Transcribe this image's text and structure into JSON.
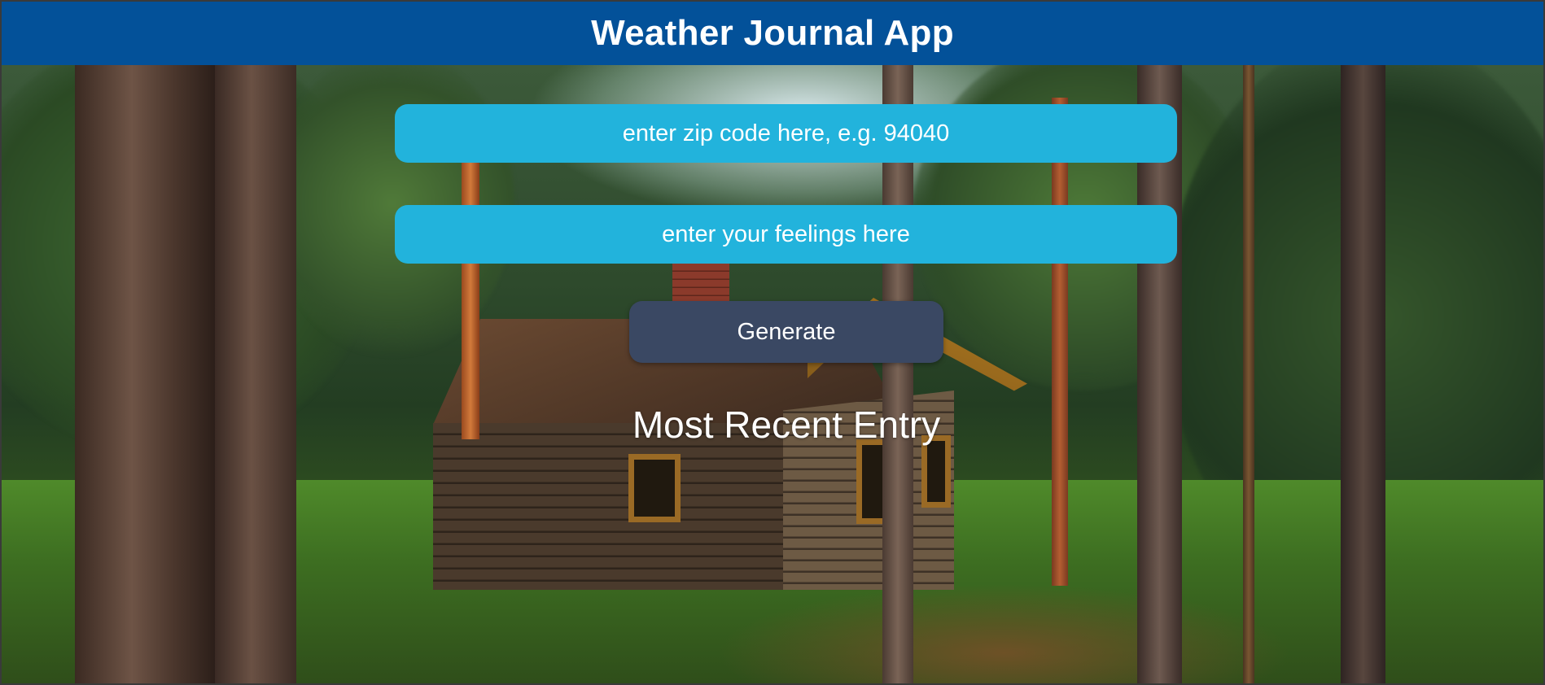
{
  "header": {
    "title": "Weather Journal App"
  },
  "form": {
    "zip_placeholder": "enter zip code here, e.g. 94040",
    "feelings_placeholder": "enter your feelings here",
    "generate_label": "Generate"
  },
  "entry": {
    "title": "Most Recent Entry"
  },
  "colors": {
    "header_bg": "#035199",
    "input_bg": "#22b3dc",
    "button_bg": "#3a4863",
    "text": "#ffffff"
  }
}
